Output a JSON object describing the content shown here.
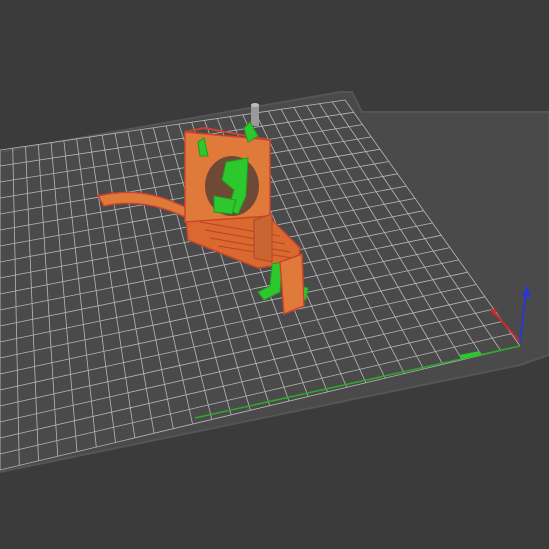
{
  "viewport": {
    "background_color": "#3b3b3b",
    "bed": {
      "plate_color": "#4a4a4a",
      "plate_edge_color": "#555555",
      "grid_color": "#b7b7b7",
      "grid_columns": 27,
      "grid_rows": 20
    },
    "model": {
      "extrusion_color": "#e07a3a",
      "perimeter_color": "#c9442e",
      "support_color": "#2dc82d",
      "purge_tower_color": "#9a9a9a"
    },
    "axes": {
      "x_color": "#d12a2a",
      "y_color": "#2daa2d",
      "z_color": "#2a38d1"
    }
  }
}
